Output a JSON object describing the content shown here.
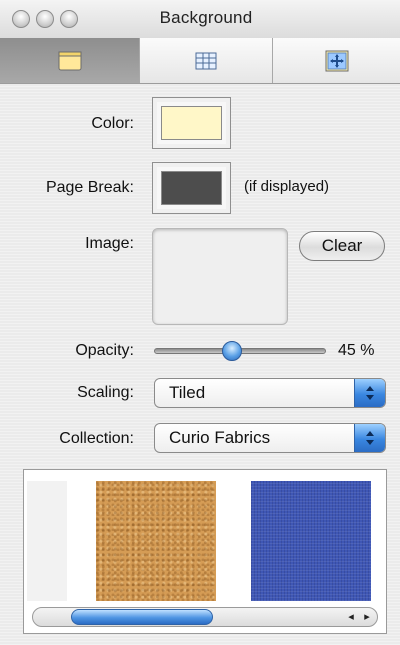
{
  "window": {
    "title": "Background"
  },
  "toolbar": {
    "tabs": [
      {
        "name": "background",
        "icon": "background-swatch-icon",
        "selected": true
      },
      {
        "name": "table",
        "icon": "table-grid-icon",
        "selected": false
      },
      {
        "name": "layout",
        "icon": "move-arrows-icon",
        "selected": false
      }
    ]
  },
  "fields": {
    "color_label": "Color:",
    "color_value": "#fff7c8",
    "page_break_label": "Page Break:",
    "page_break_value": "#4d4d4d",
    "page_break_note": "(if displayed)",
    "image_label": "Image:",
    "clear_label": "Clear",
    "opacity_label": "Opacity:",
    "opacity_value": 0.45,
    "opacity_text": "45 %",
    "scaling_label": "Scaling:",
    "scaling_value": "Tiled",
    "collection_label": "Collection:",
    "collection_value": "Curio Fabrics"
  },
  "gallery": {
    "swatches": [
      {
        "name": "white-fabric",
        "color": "#f2f2f2"
      },
      {
        "name": "tan-fabric",
        "color": "#d59c55"
      },
      {
        "name": "blue-fabric",
        "color": "#3f57b5"
      }
    ]
  },
  "colors": {
    "accent": "#3a87e0"
  }
}
